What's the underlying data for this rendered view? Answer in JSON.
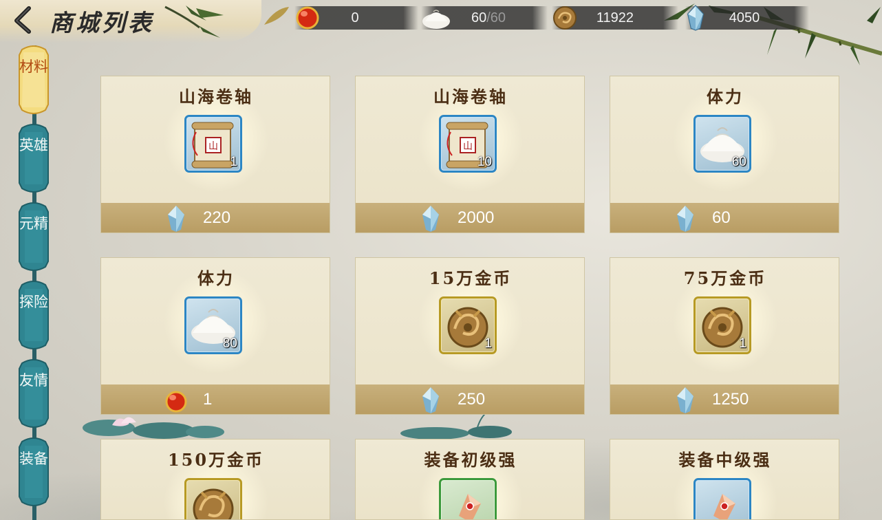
{
  "header": {
    "title": "商城列表",
    "resources": [
      {
        "icon": "red-gem-icon",
        "value": "0"
      },
      {
        "icon": "steamed-bun-icon",
        "value": "60",
        "max": "/60"
      },
      {
        "icon": "gold-coin-icon",
        "value": "11922"
      },
      {
        "icon": "blue-crystal-icon",
        "value": "4050"
      }
    ]
  },
  "sidebar": {
    "tabs": [
      {
        "label": "材料",
        "active": true
      },
      {
        "label": "英雄",
        "active": false
      },
      {
        "label": "元精",
        "active": false
      },
      {
        "label": "探险",
        "active": false
      },
      {
        "label": "友情",
        "active": false
      },
      {
        "label": "装备",
        "active": false
      }
    ]
  },
  "items": [
    {
      "name": "山海卷轴",
      "icon": "scroll-icon",
      "frame": "blue",
      "count": "1",
      "price_icon": "blue-crystal-icon",
      "price": "220"
    },
    {
      "name": "山海卷轴",
      "icon": "scroll-icon",
      "frame": "blue",
      "count": "10",
      "price_icon": "blue-crystal-icon",
      "price": "2000"
    },
    {
      "name": "体力",
      "icon": "steamed-bun-icon",
      "frame": "blue",
      "count": "60",
      "price_icon": "blue-crystal-icon",
      "price": "60"
    },
    {
      "name": "体力",
      "icon": "steamed-bun-icon",
      "frame": "blue",
      "count": "80",
      "price_icon": "red-gem-icon",
      "price": "1"
    },
    {
      "name": "15万金币",
      "icon": "gold-coin-icon",
      "frame": "gold",
      "count": "1",
      "price_icon": "blue-crystal-icon",
      "price": "250"
    },
    {
      "name": "75万金币",
      "icon": "gold-coin-icon",
      "frame": "gold",
      "count": "1",
      "price_icon": "blue-crystal-icon",
      "price": "1250"
    },
    {
      "name": "150万金币",
      "icon": "gold-coin-icon",
      "frame": "gold"
    },
    {
      "name": "装备初级强",
      "icon": "enhance-stone-icon",
      "frame": "green"
    },
    {
      "name": "装备中级强",
      "icon": "enhance-stone-icon",
      "frame": "blue"
    }
  ],
  "colors": {
    "title_text": "#4b2e14",
    "price_bar": "#bda46c",
    "frame_blue": "#2c86c4",
    "frame_gold": "#b79a24",
    "frame_green": "#3c9a3c",
    "active_tab": "#f0d77a",
    "inactive_tab": "#2e7f8a"
  }
}
